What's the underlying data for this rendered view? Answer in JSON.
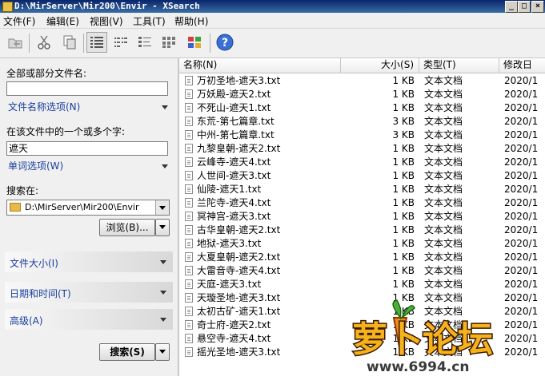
{
  "window": {
    "title": "D:\\MirServer\\Mir200\\Envir - XSearch"
  },
  "menu": {
    "items": [
      "文件(F)",
      "编辑(E)",
      "视图(V)",
      "工具(T)",
      "帮助(H)"
    ]
  },
  "left": {
    "name_label": "全部或部分文件名:",
    "name_value": "",
    "name_options": "文件名称选项(N)",
    "content_label": "在该文件中的一个或多个字:",
    "content_value": "遮天",
    "word_options": "单词选项(W)",
    "search_in_label": "搜索在:",
    "search_in_value": "D:\\MirServer\\Mir200\\Envir",
    "browse_button": "浏览(B)...",
    "size_section": "文件大小(I)",
    "date_section": "日期和时间(T)",
    "advanced_section": "高级(A)",
    "search_button": "搜索(S)"
  },
  "list": {
    "columns": [
      "名称(N)",
      "大小(S)",
      "类型(T)",
      "修改日"
    ],
    "rows": [
      {
        "name": "万初圣地-遮天3.txt",
        "size": "1 KB",
        "type": "文本文档",
        "date": "2020/1"
      },
      {
        "name": "万妖殿-遮天2.txt",
        "size": "1 KB",
        "type": "文本文档",
        "date": "2020/1"
      },
      {
        "name": "不死山-遮天1.txt",
        "size": "1 KB",
        "type": "文本文档",
        "date": "2020/1"
      },
      {
        "name": "东荒-第七篇章.txt",
        "size": "3 KB",
        "type": "文本文档",
        "date": "2020/1"
      },
      {
        "name": "中州-第七篇章.txt",
        "size": "3 KB",
        "type": "文本文档",
        "date": "2020/1"
      },
      {
        "name": "九黎皇朝-遮天2.txt",
        "size": "1 KB",
        "type": "文本文档",
        "date": "2020/1"
      },
      {
        "name": "云峰寺-遮天4.txt",
        "size": "1 KB",
        "type": "文本文档",
        "date": "2020/1"
      },
      {
        "name": "人世间-遮天3.txt",
        "size": "1 KB",
        "type": "文本文档",
        "date": "2020/1"
      },
      {
        "name": "仙陵-遮天1.txt",
        "size": "1 KB",
        "type": "文本文档",
        "date": "2020/1"
      },
      {
        "name": "兰陀寺-遮天4.txt",
        "size": "1 KB",
        "type": "文本文档",
        "date": "2020/1"
      },
      {
        "name": "冥神宫-遮天3.txt",
        "size": "1 KB",
        "type": "文本文档",
        "date": "2020/1"
      },
      {
        "name": "古华皇朝-遮天2.txt",
        "size": "1 KB",
        "type": "文本文档",
        "date": "2020/1"
      },
      {
        "name": "地狱-遮天3.txt",
        "size": "1 KB",
        "type": "文本文档",
        "date": "2020/1"
      },
      {
        "name": "大夏皇朝-遮天2.txt",
        "size": "1 KB",
        "type": "文本文档",
        "date": "2020/1"
      },
      {
        "name": "大雷音寺-遮天4.txt",
        "size": "1 KB",
        "type": "文本文档",
        "date": "2020/1"
      },
      {
        "name": "天庭-遮天3.txt",
        "size": "1 KB",
        "type": "文本文档",
        "date": "2020/1"
      },
      {
        "name": "天璇圣地-遮天3.txt",
        "size": "1 KB",
        "type": "文本文档",
        "date": "2020/1"
      },
      {
        "name": "太初古矿-遮天1.txt",
        "size": "1 KB",
        "type": "文本文档",
        "date": "2020/1"
      },
      {
        "name": "奇士府-遮天2.txt",
        "size": "1 KB",
        "type": "文本文档",
        "date": "2020/1"
      },
      {
        "name": "悬空寺-遮天4.txt",
        "size": "1 KB",
        "type": "文本文档",
        "date": "2020/1"
      },
      {
        "name": "摇光圣地-遮天3.txt",
        "size": "1 KB",
        "type": "文本文档",
        "date": "2020/1"
      }
    ]
  },
  "watermark": {
    "title": "萝卜论坛",
    "url": "www.6994.cn"
  },
  "colors": {
    "title_bar": "#0a246a",
    "link": "#1a3e9e",
    "watermark_orange": "#f28a1b"
  }
}
